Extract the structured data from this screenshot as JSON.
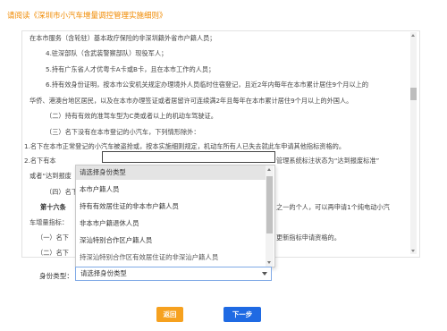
{
  "header": {
    "title": "请阅读《深圳市小汽车增量调控管理实施细则》"
  },
  "document": {
    "lines": [
      "在本市服务（含轮驻）基本政疗保险的非深圳籍外省市户籍人员；",
      "4.驻深部队（含武装警察部队）现役军人；",
      "5.持有广东省人才优粤卡A卡或B卡，且在本市工作的人员；",
      "6.持有效身份证明，按本市公安机关规定办理境外人员临时住宿登记，且近2年内每年在本市累计居住9个月以上的",
      "华侨、港澳台地区居民，以及在本市办理签证或者居留许可连续满2年且每年在本市累计居住9个月以上的外国人。",
      "（二）持有有效的准驾车型为C类或者以上的机动车驾驶证。",
      "（三）名下没有在本市登记的小汽车，下列情形除外：",
      "1.名下在本市正常登记的小汽车被盗抢或，按本实施细则规定，机动车所有人已失去就此车申请其他指标资格的。",
      "2.名下有本",
      "管理系统标注状态为“达到报废标准”",
      "或者“达到报废",
      "（四）名下",
      "第十六条",
      "之一的个人，可以再申请1个纯电动小汽",
      "车增量指标：",
      "（一）名下",
      "更新指标申请资格的。",
      "（二）名下"
    ]
  },
  "dropdown": {
    "options": [
      "请选择身份类型",
      "本市户籍人员",
      "持有有效居住证的非本市户籍人员",
      "非本市户籍退休人员",
      "深汕特别合作区户籍人员",
      "持深汕特别合作区有效居住证的非深汕户籍人员"
    ],
    "selected_index": 0
  },
  "form": {
    "identity_label": "身份类型：",
    "identity_select_value": "请选择身份类型"
  },
  "buttons": {
    "back": "返回",
    "next": "下一步"
  },
  "colors": {
    "header_text": "#f08a00",
    "back_button": "#f6a11f",
    "next_button": "#1f6ae3"
  }
}
